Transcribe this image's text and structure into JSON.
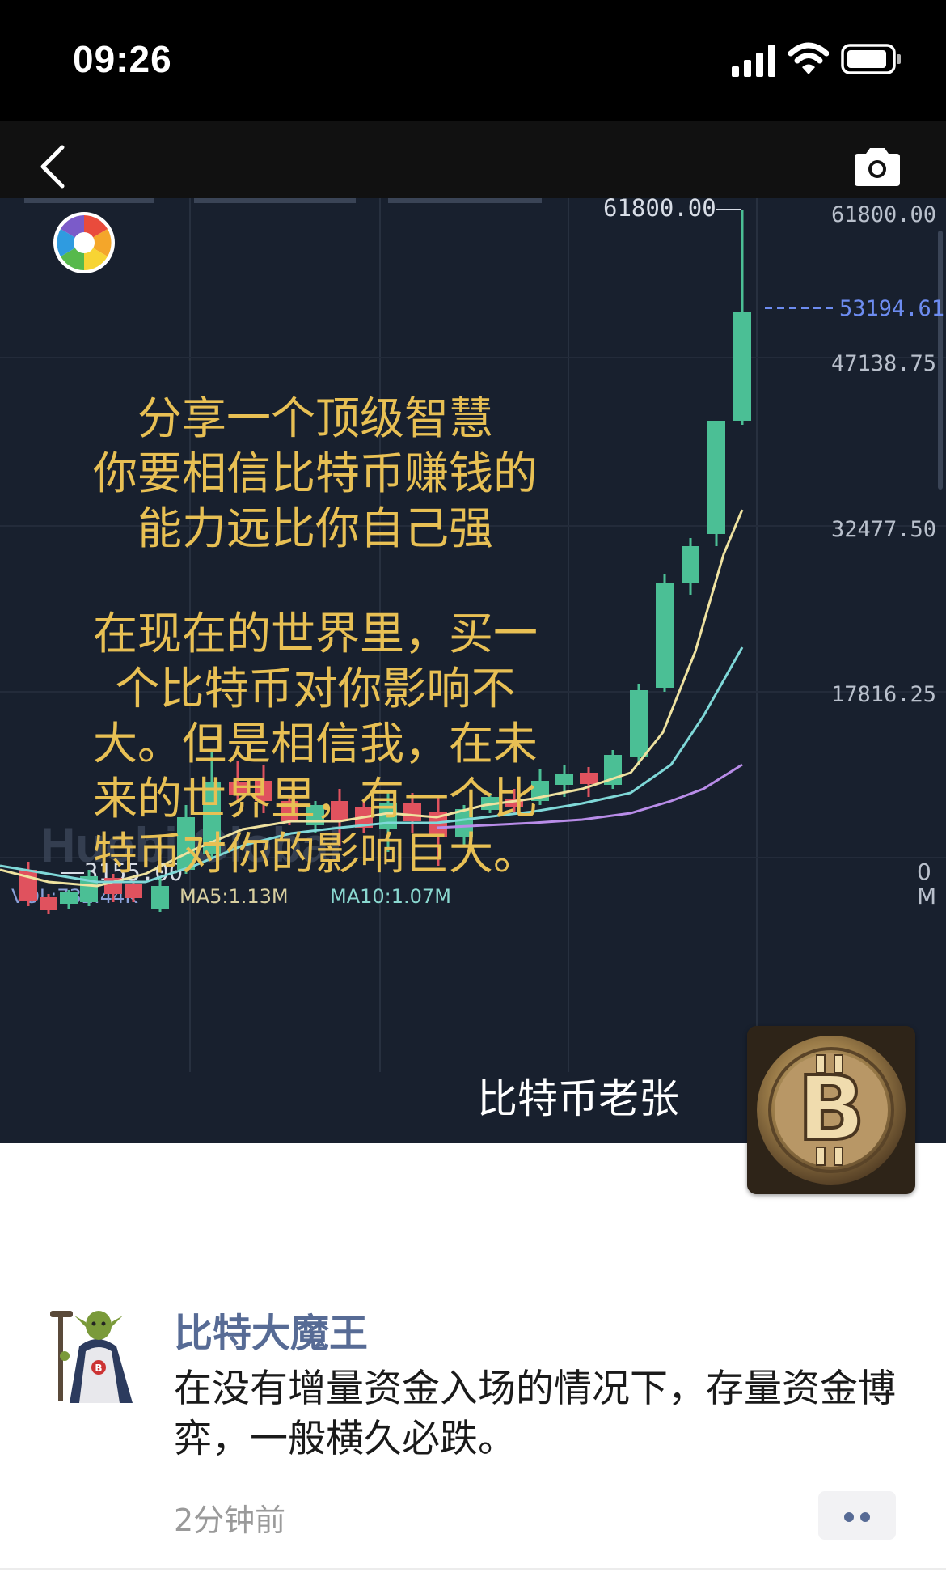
{
  "status_bar": {
    "time": "09:26"
  },
  "nav": {
    "back_icon": "chevron-left-icon",
    "camera_icon": "camera-icon"
  },
  "chart": {
    "price_labels": [
      "61800.00",
      "53194.61",
      "47138.75",
      "32477.50",
      "17816.25"
    ],
    "peak_label": "61800.00",
    "low_label": "3155.00",
    "watermark": "Huobi Global",
    "indicators": {
      "vol": "VOL:732.44K",
      "ma5": "MA5:1.13M",
      "ma10": "MA10:1.07M"
    },
    "edge_labels": [
      "0",
      "M"
    ],
    "colors": {
      "up": "#4bbf95",
      "down": "#e0525e",
      "ma_yellow": "#efe2a0",
      "ma_cyan": "#7fd8d8",
      "ma_purple": "#b88ce8",
      "gold_text": "#e8c054"
    }
  },
  "overlay": {
    "line1": "分享一个顶级智慧",
    "line2": "你要相信比特币赚钱的",
    "line3": "能力远比你自己强",
    "line4": "在现在的世界里，买一",
    "line5": "个比特币对你影响不",
    "line6": "大。但是相信我，在未",
    "line7": "来的世界里，有一个比",
    "line8": "特币对你的影响巨大。",
    "author": "比特币老张"
  },
  "comment": {
    "name": "比特大魔王",
    "text": "在没有增量资金入场的情况下，存量资金博弈，一般横久必跌。",
    "time": "2分钟前"
  }
}
